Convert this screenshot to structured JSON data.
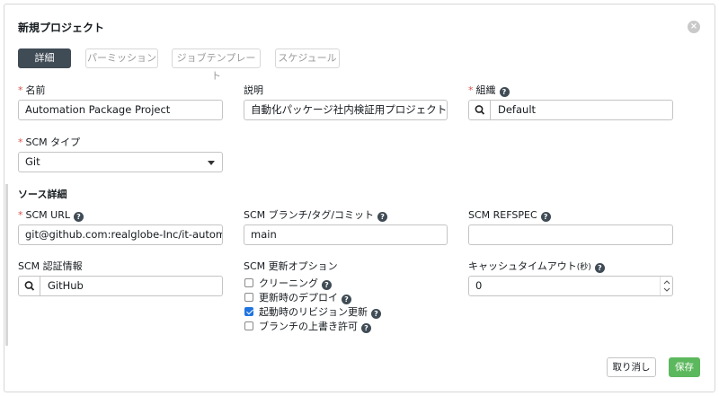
{
  "title": "新規プロジェクト",
  "tabs": [
    {
      "label": "詳細",
      "active": true
    },
    {
      "label": "パーミッション",
      "active": false
    },
    {
      "label": "ジョブテンプレート",
      "active": false
    },
    {
      "label": "スケジュール",
      "active": false
    }
  ],
  "fields": {
    "name": {
      "label": "名前",
      "required_mark": "*",
      "value": "Automation Package Project"
    },
    "description": {
      "label": "説明",
      "value": "自動化パッケージ社内検証用プロジェクト"
    },
    "organization": {
      "label": "組織",
      "required_mark": "*",
      "value": "Default"
    },
    "scm_type": {
      "label": "SCM タイプ",
      "required_mark": "*",
      "value": "Git"
    }
  },
  "source": {
    "section_title": "ソース詳細",
    "scm_url": {
      "label": "SCM URL",
      "required_mark": "*",
      "value": "git@github.com:realglobe-Inc/it-automatio"
    },
    "scm_branch": {
      "label": "SCM ブランチ/タグ/コミット",
      "value": "main"
    },
    "scm_refspec": {
      "label": "SCM REFSPEC",
      "value": ""
    },
    "credential": {
      "label": "SCM 認証情報",
      "value": "GitHub"
    },
    "update_options": {
      "label": "SCM 更新オプション",
      "items": [
        {
          "label": "クリーニング",
          "checked": false
        },
        {
          "label": "更新時のデプロイ",
          "checked": false
        },
        {
          "label": "起動時のリビジョン更新",
          "checked": true
        },
        {
          "label": "ブランチの上書き許可",
          "checked": false
        }
      ]
    },
    "cache_timeout": {
      "label": "キャッシュタイムアウト",
      "unit": "(秒)",
      "value": "0"
    }
  },
  "buttons": {
    "cancel": "取り消し",
    "save": "保存"
  },
  "colors": {
    "accent_dark": "#3f4b55",
    "required": "#d9534f",
    "save": "#5cb85c",
    "checkbox": "#1f74e0"
  },
  "icons": {
    "close": "close-icon",
    "help": "question-circle-icon",
    "search": "search-icon",
    "dropdown": "caret-down-icon"
  }
}
